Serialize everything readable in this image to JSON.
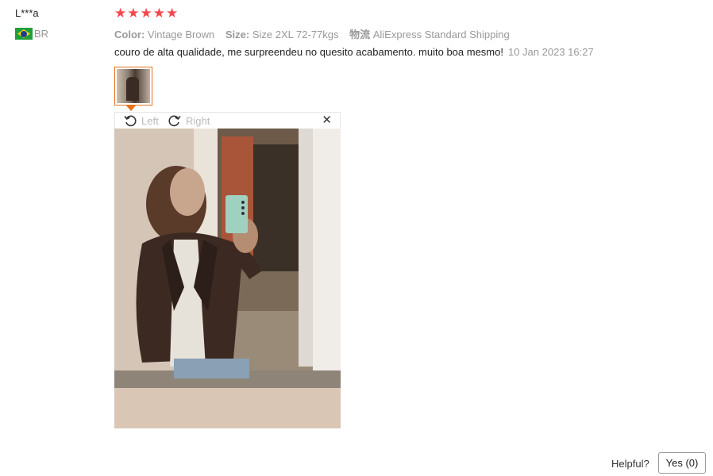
{
  "review": {
    "user_name": "L***a",
    "country_code": "BR",
    "rating": 5,
    "star_glyph": "★",
    "star_color": "#f5474c",
    "attributes": [
      {
        "key": "Color:",
        "value": "Vintage Brown"
      },
      {
        "key": "Size:",
        "value": "Size 2XL 72-77kgs"
      },
      {
        "key": "物流",
        "value": "AliExpress Standard Shipping"
      }
    ],
    "text": "couro de alta qualidade, me surpreendeu no quesito acabamento. muito boa mesmo!",
    "date": "10 Jan 2023 16:27"
  },
  "viewer": {
    "rotate_left_label": "Left",
    "rotate_right_label": "Right",
    "close_glyph": "✕",
    "accent_color": "#e5721e"
  },
  "footer": {
    "helpful_label": "Helpful?",
    "yes_label": "Yes (0)"
  }
}
